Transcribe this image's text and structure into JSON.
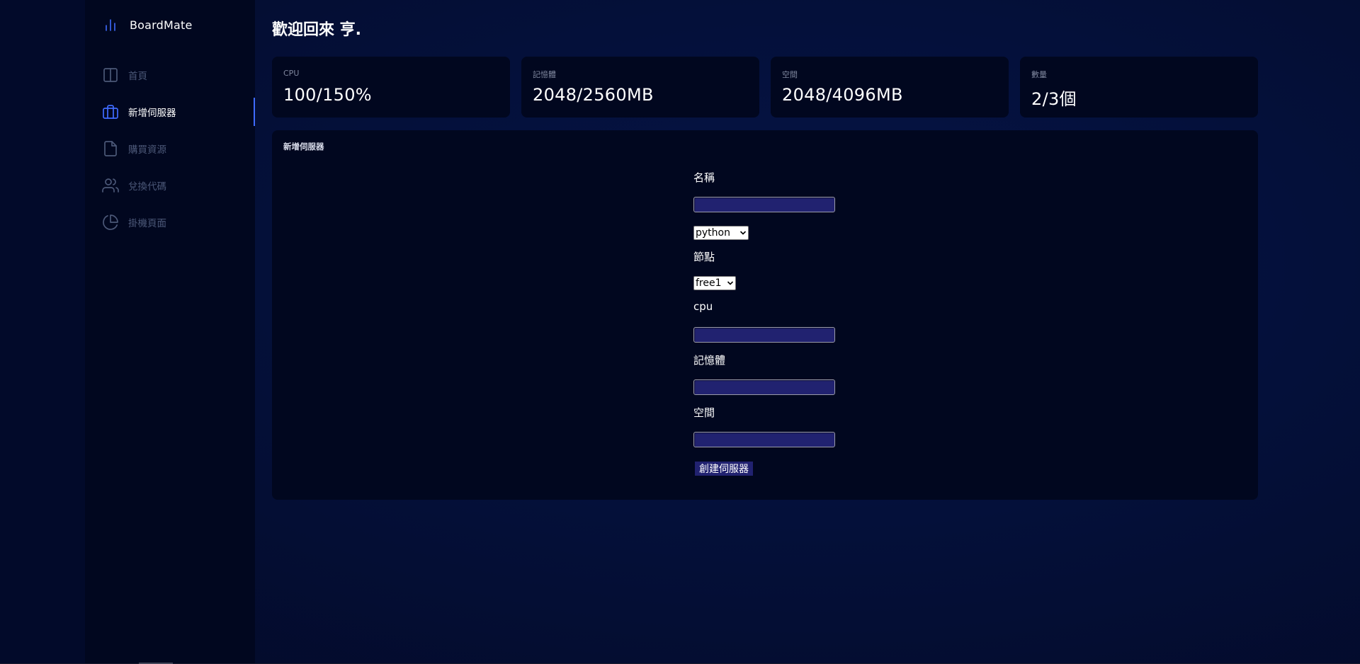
{
  "app": {
    "brand": "BoardMate",
    "welcome": "歡迎回來 亨."
  },
  "sidebar": {
    "items": [
      {
        "label": "首頁",
        "icon": "layout-columns-icon",
        "active": false
      },
      {
        "label": "新增伺服器",
        "icon": "briefcase-icon",
        "active": true
      },
      {
        "label": "購買資源",
        "icon": "file-icon",
        "active": false
      },
      {
        "label": "兌換代碼",
        "icon": "users-icon",
        "active": false
      },
      {
        "label": "掛機頁面",
        "icon": "pie-chart-icon",
        "active": false
      }
    ]
  },
  "stats": [
    {
      "label": "CPU",
      "value": "100/150%"
    },
    {
      "label": "記憶體",
      "value": "2048/2560MB"
    },
    {
      "label": "空間",
      "value": "2048/4096MB"
    },
    {
      "label": "數量",
      "value": "2/3個"
    }
  ],
  "panel": {
    "title": "新增伺服器"
  },
  "form": {
    "name_label": "名稱",
    "name_value": "",
    "language_selected": "python",
    "node_label": "節點",
    "node_selected": "free1",
    "cpu_label": "cpu",
    "cpu_value": "",
    "memory_label": "記憶體",
    "memory_value": "",
    "disk_label": "空間",
    "disk_value": "",
    "submit_label": "創建伺服器"
  },
  "colors": {
    "accent": "#3f6bff",
    "sidebar_bg": "#01071f",
    "input_bg": "#212270",
    "page_bg": "#04103a"
  }
}
